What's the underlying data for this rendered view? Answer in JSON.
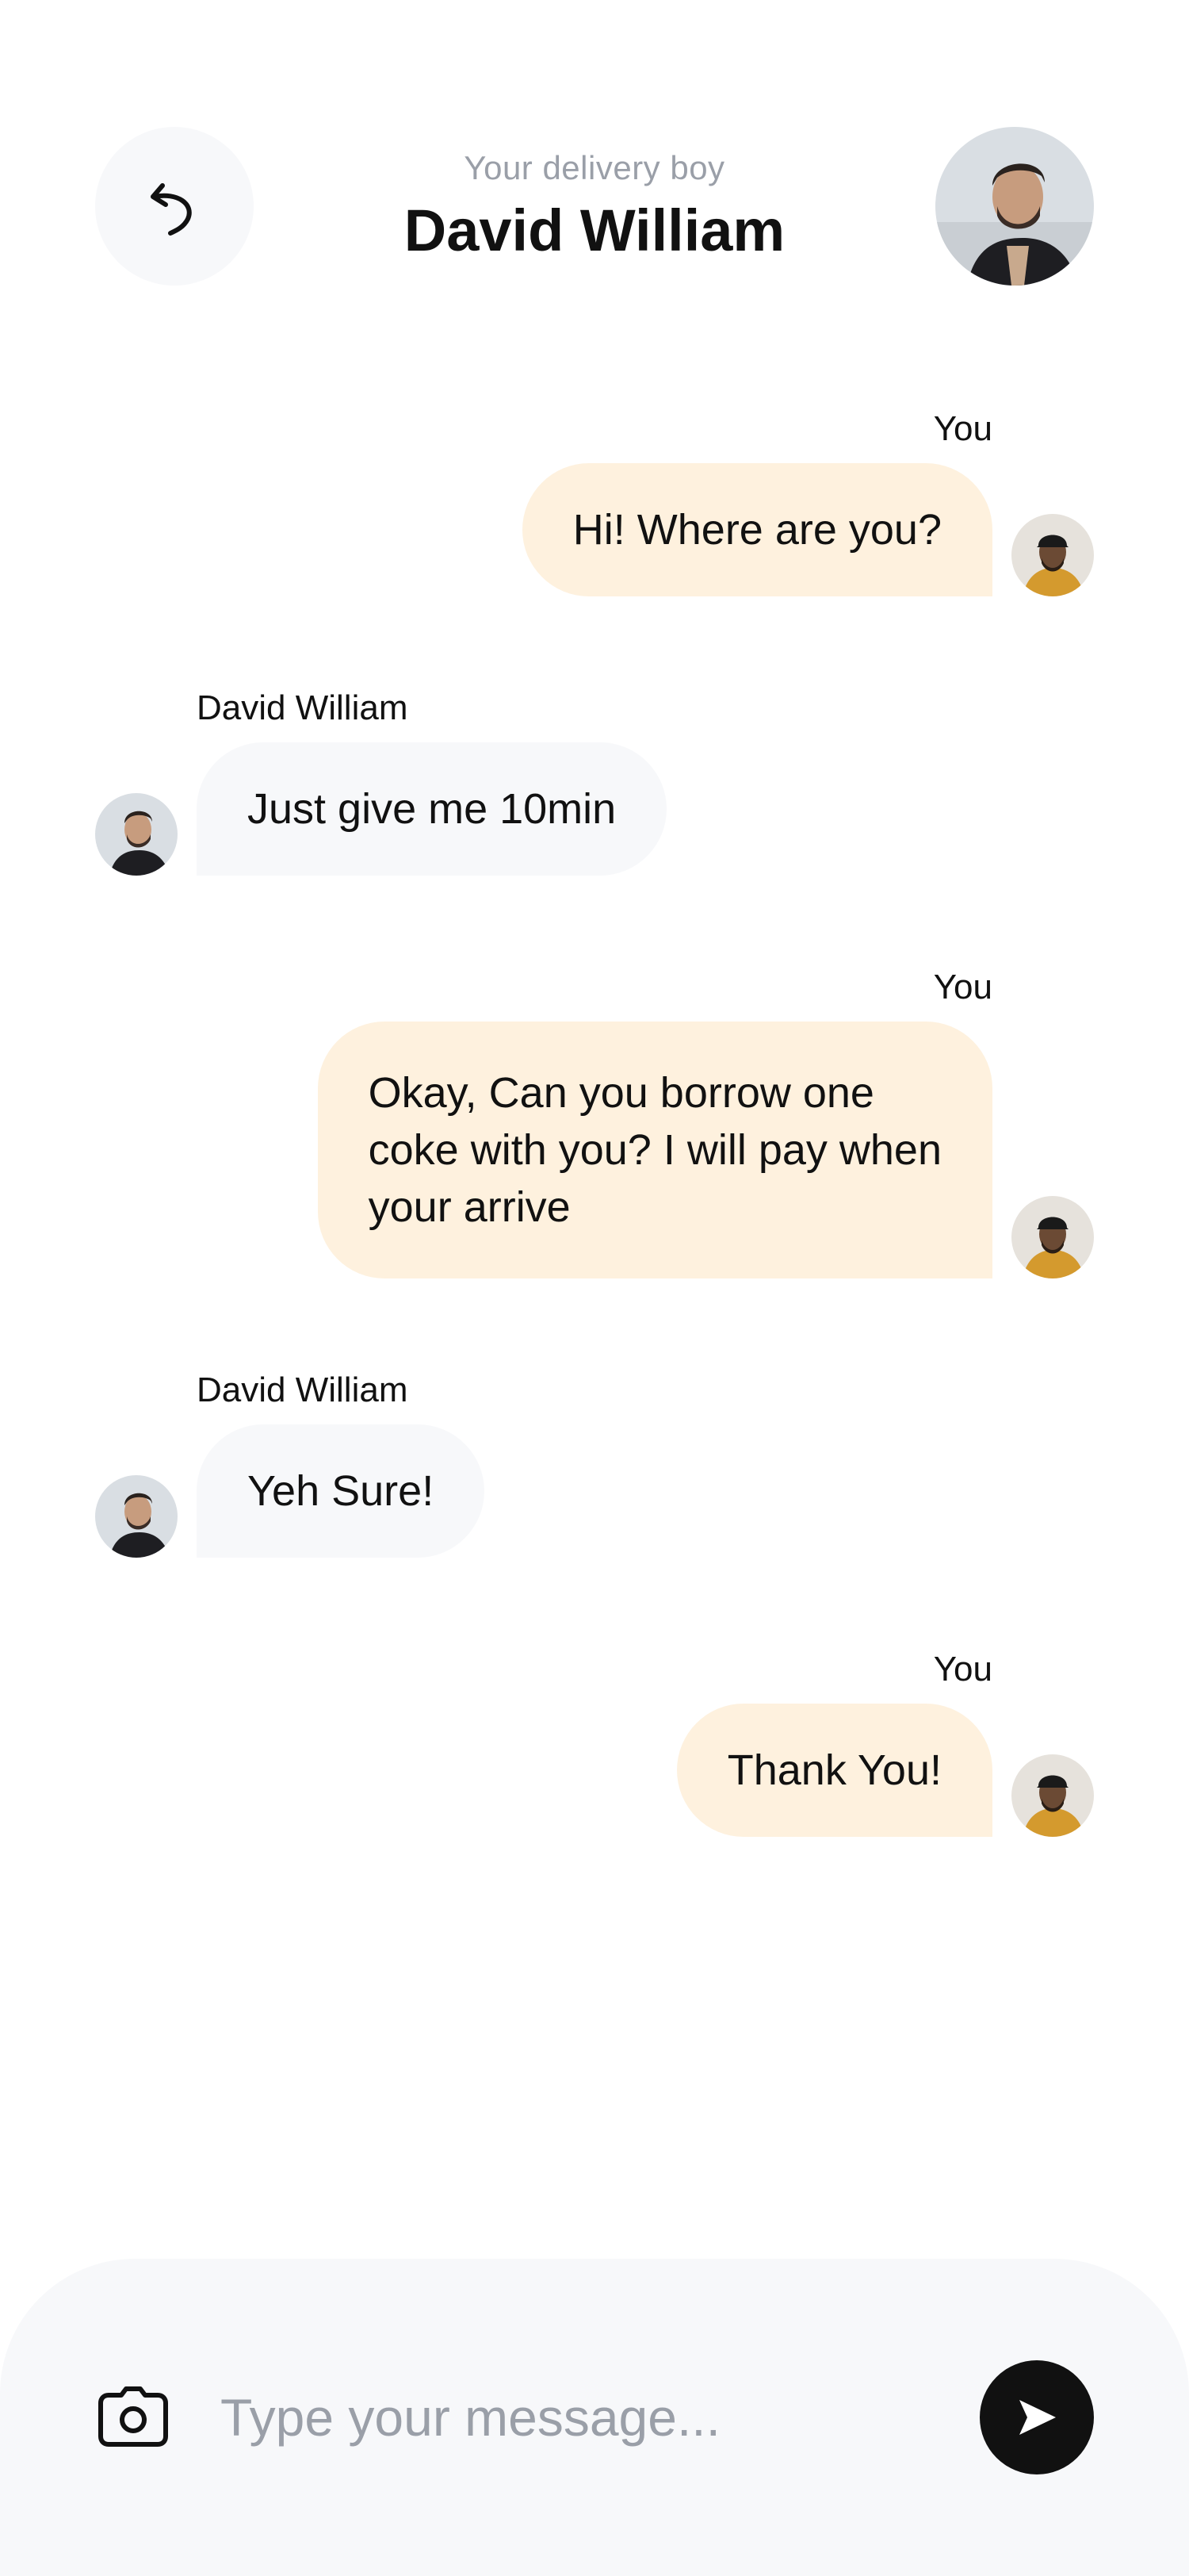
{
  "header": {
    "subtitle": "Your delivery boy",
    "title": "David William",
    "back_icon": "undo-arrow-icon",
    "avatar": "courier-avatar"
  },
  "messages": [
    {
      "sender": "You",
      "text": "Hi! Where are you?",
      "from_me": true
    },
    {
      "sender": "David William",
      "text": "Just give me 10min",
      "from_me": false
    },
    {
      "sender": "You",
      "lines": [
        "Okay, Can you borrow one",
        "coke with you? I will pay when",
        "your arrive"
      ],
      "from_me": true
    },
    {
      "sender": "David William",
      "text": "Yeh Sure!",
      "from_me": false
    },
    {
      "sender": "You",
      "text": "Thank You!",
      "from_me": true
    }
  ],
  "composer": {
    "placeholder": "Type your message...",
    "camera_icon": "camera-icon",
    "send_icon": "send-icon"
  },
  "colors": {
    "my_bubble": "#FEF1DE",
    "their_bubble": "#F7F8FA",
    "muted_text": "#9A9FA8",
    "send_button": "#111111"
  }
}
